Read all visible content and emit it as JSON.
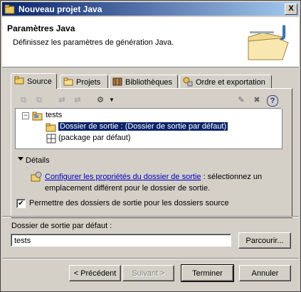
{
  "window": {
    "title": "Nouveau projet Java",
    "close_label": "X"
  },
  "banner": {
    "title": "Paramètres Java",
    "description": "Définissez les paramètres de génération Java."
  },
  "tabs": [
    {
      "label": "Source",
      "icon": "source-folder-icon",
      "active": true
    },
    {
      "label": "Projets",
      "icon": "projects-folder-icon",
      "active": false
    },
    {
      "label": "Bibliothèques",
      "icon": "libraries-icon",
      "active": false
    },
    {
      "label": "Ordre et exportation",
      "icon": "order-export-icon",
      "active": false
    }
  ],
  "tree": {
    "root": "tests",
    "children": [
      {
        "label": "Dossier de sortie : (Dossier de sortie par défaut)",
        "selected": true
      },
      {
        "label": "(package par défaut)",
        "selected": false
      }
    ]
  },
  "details": {
    "label": "Détails",
    "link": "Configurer les propriétés du dossier de sortie",
    "link_suffix": " : sélectionnez un emplacement différent pour le dossier de sortie."
  },
  "allow_output_folders": {
    "label": "Permettre des dossiers de sortie pour les dossiers source",
    "checked": true,
    "check_glyph": "✔"
  },
  "default_output": {
    "label": "Dossier de sortie par défaut :",
    "value": "tests",
    "browse_label": "Parcourir..."
  },
  "buttons": {
    "back": "< Précédent",
    "next": "Suivant >",
    "finish": "Terminer",
    "cancel": "Annuler"
  },
  "colors": {
    "selection": "#0a246a",
    "link": "#0000c0",
    "title_gradient_start": "#0a246a"
  }
}
